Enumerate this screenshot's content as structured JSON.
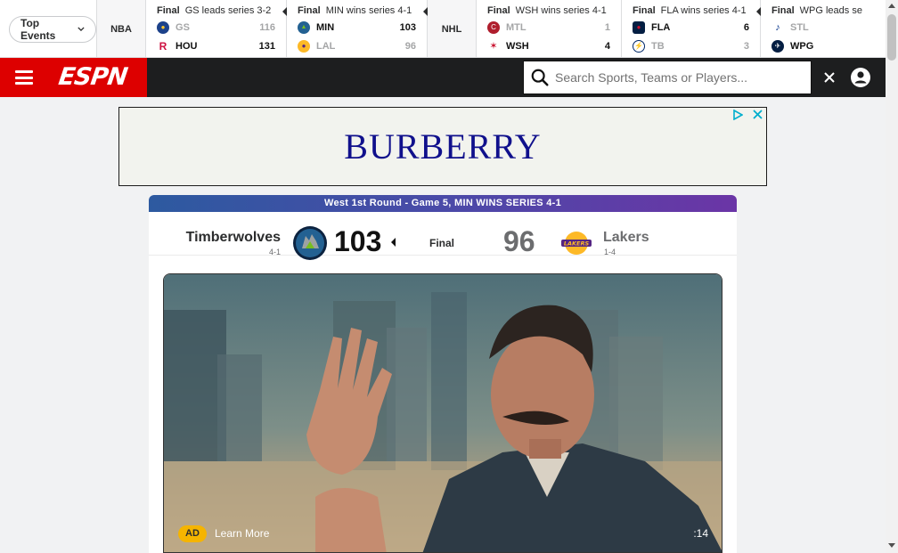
{
  "scores_strip": {
    "top_events_label": "Top Events",
    "leagues": [
      {
        "name": "NBA",
        "games": [
          {
            "status": "Final",
            "note": "GS leads series 3-2",
            "team1": {
              "abbr": "GS",
              "score": "116",
              "color": "#1d428a",
              "icon": "warriors-logo-icon"
            },
            "team2": {
              "abbr": "HOU",
              "score": "131",
              "color": "#ce1141",
              "icon": "rockets-logo-icon"
            }
          },
          {
            "status": "Final",
            "note": "MIN wins series 4-1",
            "team1": {
              "abbr": "MIN",
              "score": "103",
              "color": "#236192",
              "icon": "timberwolves-logo-icon"
            },
            "team2": {
              "abbr": "LAL",
              "score": "96",
              "color": "#fdb927",
              "icon": "lakers-logo-icon"
            }
          }
        ]
      },
      {
        "name": "NHL",
        "games": [
          {
            "status": "Final",
            "note": "WSH wins series 4-1",
            "team1": {
              "abbr": "MTL",
              "score": "1",
              "color": "#af1e2d",
              "icon": "canadiens-logo-icon"
            },
            "team2": {
              "abbr": "WSH",
              "score": "4",
              "color": "#c8102e",
              "icon": "capitals-logo-icon"
            }
          },
          {
            "status": "Final",
            "note": "FLA wins series 4-1",
            "team1": {
              "abbr": "FLA",
              "score": "6",
              "color": "#c8102e",
              "icon": "panthers-logo-icon"
            },
            "team2": {
              "abbr": "TB",
              "score": "3",
              "color": "#002868",
              "icon": "lightning-logo-icon"
            }
          },
          {
            "status": "Final",
            "note": "WPG leads se",
            "team1": {
              "abbr": "STL",
              "score": "",
              "color": "#002f87",
              "icon": "blues-logo-icon"
            },
            "team2": {
              "abbr": "WPG",
              "score": "",
              "color": "#041e42",
              "icon": "jets-logo-icon"
            }
          }
        ]
      }
    ]
  },
  "navbar": {
    "logo_text": "ESPN",
    "search_placeholder": "Search Sports, Teams or Players...",
    "brand_red": "#d00000"
  },
  "ad_banner": {
    "brand": "BURBERRY"
  },
  "game_card": {
    "header": "West 1st Round - Game 5, MIN WINS SERIES 4-1",
    "status": "Final",
    "home": {
      "name": "Timberwolves",
      "record": "4-1",
      "score": "103"
    },
    "away": {
      "name": "Lakers",
      "record": "1-4",
      "score": "96"
    },
    "video": {
      "ad_badge": "AD",
      "learn_more": "Learn More",
      "duration": ":14"
    }
  }
}
